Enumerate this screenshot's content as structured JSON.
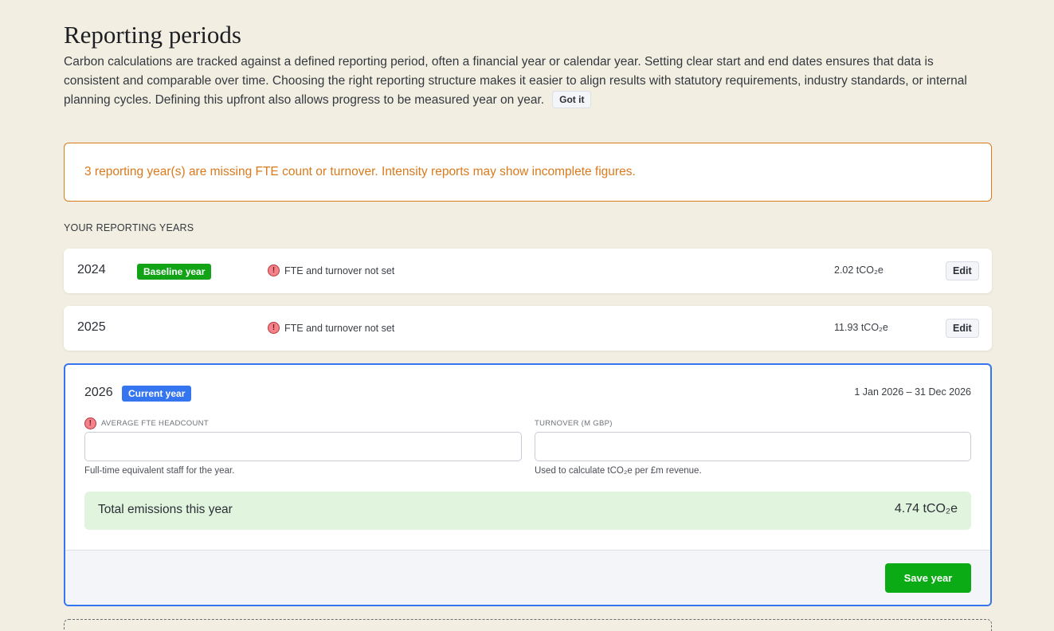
{
  "header": {
    "title": "Reporting periods",
    "intro": "Carbon calculations are tracked against a defined reporting period, often a financial year or calendar year. Setting clear start and end dates ensures that data is consistent and comparable over time. Choosing the right reporting structure makes it easier to align results with statutory requirements, industry standards, or internal planning cycles. Defining this upfront also allows progress to be measured year on year.",
    "got_it_label": "Got it"
  },
  "alert": {
    "text": "3 reporting year(s) are missing FTE count or turnover. Intensity reports may show incomplete figures.",
    "color": "#d97a1d"
  },
  "section_label": "YOUR REPORTING YEARS",
  "years": [
    {
      "year": "2024",
      "badge": "Baseline year",
      "warning": "FTE and turnover not set",
      "emissions": "2.02 tCO₂e",
      "edit_label": "Edit"
    },
    {
      "year": "2025",
      "warning": "FTE and turnover not set",
      "emissions": "11.93 tCO₂e",
      "edit_label": "Edit"
    }
  ],
  "current_year": {
    "year": "2026",
    "badge": "Current year",
    "dates": "1 Jan 2026 – 31 Dec 2026",
    "fte_label": "AVERAGE FTE HEADCOUNT",
    "fte_value": "",
    "fte_help": "Full-time equivalent staff for the year.",
    "turnover_label": "TURNOVER (M GBP)",
    "turnover_value": "",
    "turnover_help": "Used to calculate tCO₂e per £m revenue.",
    "total_label": "Total emissions this year",
    "total_value": "4.74 tCO₂e",
    "save_label": "Save year"
  },
  "warning_icon_glyph": "!",
  "colors": {
    "background": "#f2efe2",
    "accent_blue": "#3575f0",
    "baseline_green": "#12a317",
    "save_green": "#0aab14",
    "total_bg": "#e1f4de",
    "warning_red": "#f2838a"
  }
}
